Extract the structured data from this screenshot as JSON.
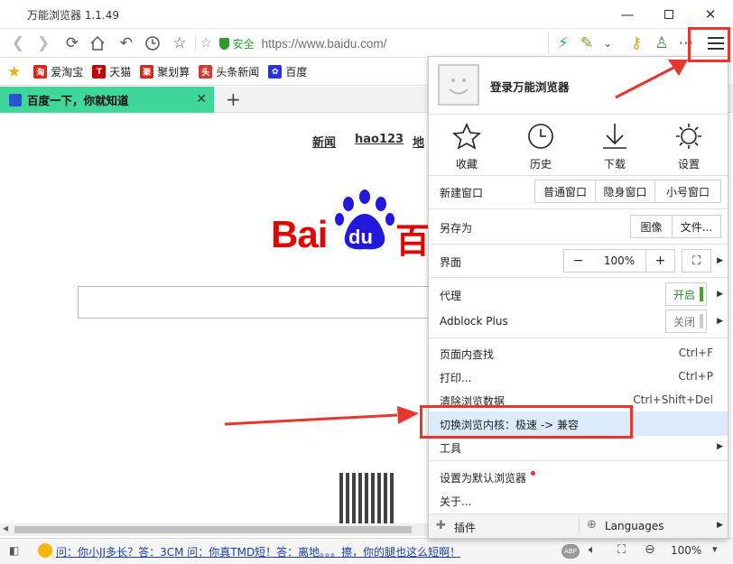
{
  "window": {
    "title": "万能浏览器 1.1.49"
  },
  "navbar": {
    "secure_label": "安全",
    "url": "https://www.baidu.com/"
  },
  "bookmarks": [
    {
      "label": "爱淘宝",
      "icon": "taobao-icon",
      "color": "#e2231a"
    },
    {
      "label": "天猫",
      "icon": "tmall-icon",
      "color": "#c40000"
    },
    {
      "label": "聚划算",
      "icon": "juhuasuan-icon",
      "color": "#e2231a"
    },
    {
      "label": "头条新闻",
      "icon": "toutiao-icon",
      "color": "#d43c33"
    },
    {
      "label": "百度",
      "icon": "baidu-icon",
      "color": "#2932e1"
    }
  ],
  "tab": {
    "label": "百度一下，你就知道"
  },
  "page": {
    "links": [
      "新闻",
      "hao123",
      "地"
    ],
    "logo_text": "Bai",
    "logo_du": "du",
    "logo_cn": "百"
  },
  "status": {
    "ticker": "问：你小JJ多长？答：3CM 问：你真TMD短！答：离地。。。擦，你的腿也这么短啊！",
    "abp": "ABP",
    "zoom": "100%"
  },
  "menu": {
    "login": "登录万能浏览器",
    "quick": [
      {
        "label": "收藏",
        "icon": "star-icon"
      },
      {
        "label": "历史",
        "icon": "clock-icon"
      },
      {
        "label": "下载",
        "icon": "download-icon"
      },
      {
        "label": "设置",
        "icon": "gear-icon"
      }
    ],
    "new_window": "新建窗口",
    "new_window_opts": [
      "普通窗口",
      "隐身窗口",
      "小号窗口"
    ],
    "save_as": "另存为",
    "save_as_opts": [
      "图像",
      "文件..."
    ],
    "ui": "界面",
    "zoom_minus": "−",
    "zoom_value": "100%",
    "zoom_plus": "+",
    "proxy": "代理",
    "proxy_state": "开启",
    "adblock": "Adblock Plus",
    "adblock_state": "关闭",
    "find": "页面内查找",
    "find_sc": "Ctrl+F",
    "print": "打印...",
    "print_sc": "Ctrl+P",
    "clear": "清除浏览数据",
    "clear_sc": "Ctrl+Shift+Del",
    "switch_kernel": "切换浏览内核：极速 -> 兼容",
    "tools": "工具",
    "default_browser": "设置为默认浏览器",
    "about": "关于...",
    "plugins": "插件",
    "languages": "Languages"
  },
  "colors": {
    "accent_tab": "#3fd79a",
    "highlight_row": "#dcebfb",
    "annotation_red": "#e8352e",
    "secure_green": "#2a9e2a"
  }
}
